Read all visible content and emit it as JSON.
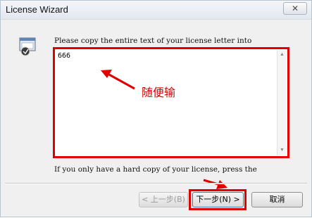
{
  "window": {
    "title": "License Wizard",
    "close_symbol": "✕"
  },
  "prompt_text": "Please copy the entire text of your license letter into",
  "license_text_value": "666",
  "annotation_label": "随便输",
  "footer_text": "If you only have a hard copy of your license, press the",
  "buttons": {
    "back_label": "< 上一步(B)",
    "next_label": "下一步(N) >",
    "cancel_label": "取消"
  },
  "colors": {
    "annotation_red": "#e00000",
    "window_bg": "#f0f0f0"
  },
  "icons": {
    "app_icon": "license-wizard-icon",
    "scroll_up": "scroll-up-arrow-icon",
    "scroll_down": "scroll-down-arrow-icon"
  }
}
